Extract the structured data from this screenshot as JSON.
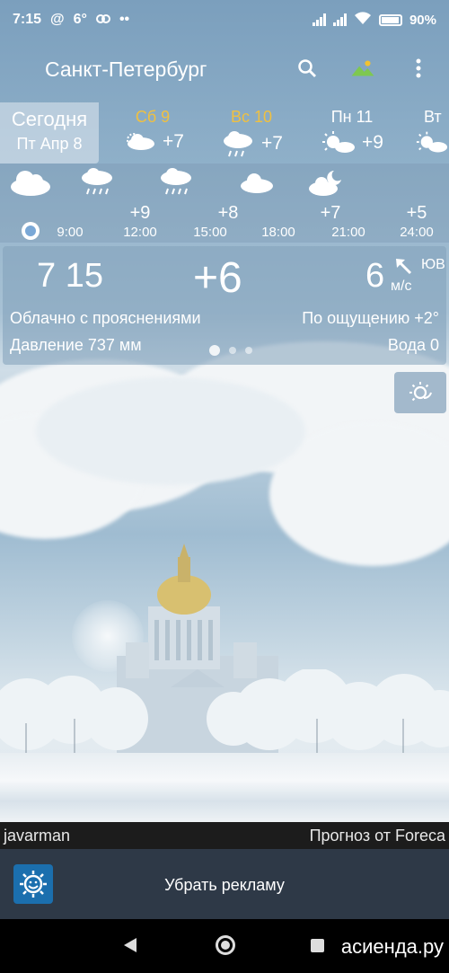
{
  "status_bar": {
    "time": "7:15",
    "notif_at": "@",
    "notif_temp": "6°",
    "battery": "90%"
  },
  "app_bar": {
    "title": "Санкт-Петербург",
    "icons": [
      "search-icon",
      "landscape-icon",
      "more-vert-icon"
    ]
  },
  "days": [
    {
      "name": "Сегодня",
      "date": "Пт Апр 8"
    },
    {
      "name": "Сб 9",
      "temp": "+7",
      "icon": "partly-cloudy-rain"
    },
    {
      "name": "Вс 10",
      "temp": "+7",
      "icon": "rain"
    },
    {
      "name": "Пн 11",
      "temp": "+9",
      "icon": "partly-sunny"
    },
    {
      "name": "Вт",
      "icon": "partly-sunny"
    }
  ],
  "hourly": [
    {
      "time": "9:00",
      "temp": "",
      "icon": "cloudy"
    },
    {
      "time": "12:00",
      "temp": "+9",
      "icon": "rain"
    },
    {
      "time": "15:00",
      "temp": "+8",
      "icon": "rain"
    },
    {
      "time": "18:00",
      "temp": "",
      "icon": "cloudy"
    },
    {
      "time": "21:00",
      "temp": "+7",
      "icon": "cloudy-night"
    },
    {
      "time": "24:00",
      "temp": "+5",
      "icon": ""
    }
  ],
  "current": {
    "time": "7 15",
    "temp": "+6",
    "wind_speed": "6",
    "wind_dir": "ЮВ",
    "wind_unit": "м/с",
    "condition": "Облачно с прояснениями",
    "feels_like": "По ощущению +2°",
    "pressure": "Давление 737 мм",
    "water": "Вода 0",
    "page_index": 1,
    "page_count": 3
  },
  "credits": {
    "left": "javarman",
    "right": "Прогноз от Foreca"
  },
  "ad": {
    "label": "Убрать рекламу"
  },
  "watermark": "асиенда.ру",
  "colors": {
    "day_name_accent": "#f0c040",
    "ad_bar": "#2e3947",
    "ad_icon": "#1b6fae"
  }
}
